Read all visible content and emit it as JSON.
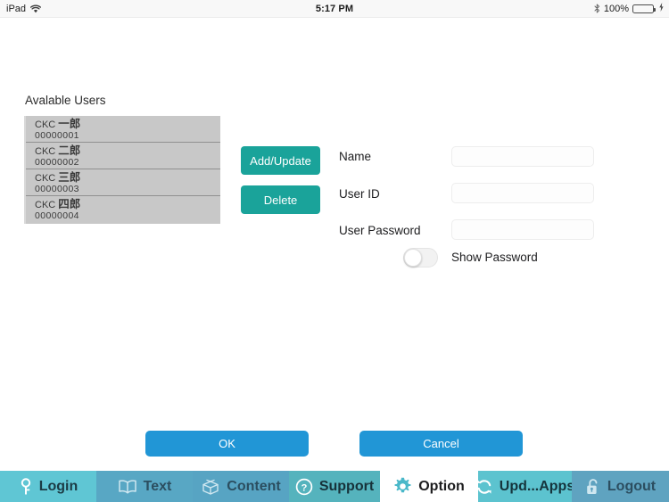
{
  "status_bar": {
    "device": "iPad",
    "wifi_icon": "wifi-icon",
    "time": "5:17 PM",
    "bluetooth_icon": "bluetooth-icon",
    "battery_percent": "100%",
    "battery_icon": "battery-full-icon",
    "charging_icon": "lightning-bolt-icon",
    "battery_color": "#4cd964"
  },
  "main": {
    "users_label": "Avalable Users",
    "users": [
      {
        "prefix": "CKC",
        "name": "一郎",
        "id": "00000001"
      },
      {
        "prefix": "CKC",
        "name": "二郎",
        "id": "00000002"
      },
      {
        "prefix": "CKC",
        "name": "三郎",
        "id": "00000003"
      },
      {
        "prefix": "CKC",
        "name": "四郎",
        "id": "00000004"
      }
    ],
    "actions": {
      "add_update_label": "Add/Update",
      "delete_label": "Delete",
      "accent_color": "#1aa39a"
    },
    "form": {
      "name_label": "Name",
      "name_value": "",
      "name_placeholder": "",
      "userid_label": "User ID",
      "userid_value": "",
      "userid_placeholder": "",
      "password_label": "User Password",
      "password_value": "",
      "password_placeholder": "",
      "show_password_label": "Show Password",
      "show_password_state": "off"
    },
    "footer": {
      "ok_label": "OK",
      "cancel_label": "Cancel",
      "button_color": "#2196d6"
    }
  },
  "tabbar": {
    "tabs": [
      {
        "label": "Login",
        "icon": "key-icon",
        "selected": false
      },
      {
        "label": "Text",
        "icon": "book-icon",
        "selected": false
      },
      {
        "label": "Content",
        "icon": "box-icon",
        "selected": false
      },
      {
        "label": "Support",
        "icon": "help-icon",
        "selected": false
      },
      {
        "label": "Option",
        "icon": "gear-icon",
        "selected": true
      },
      {
        "label": "Upd...Apps",
        "icon": "refresh-icon",
        "selected": false
      },
      {
        "label": "Logout",
        "icon": "unlock-icon",
        "selected": false
      }
    ]
  }
}
